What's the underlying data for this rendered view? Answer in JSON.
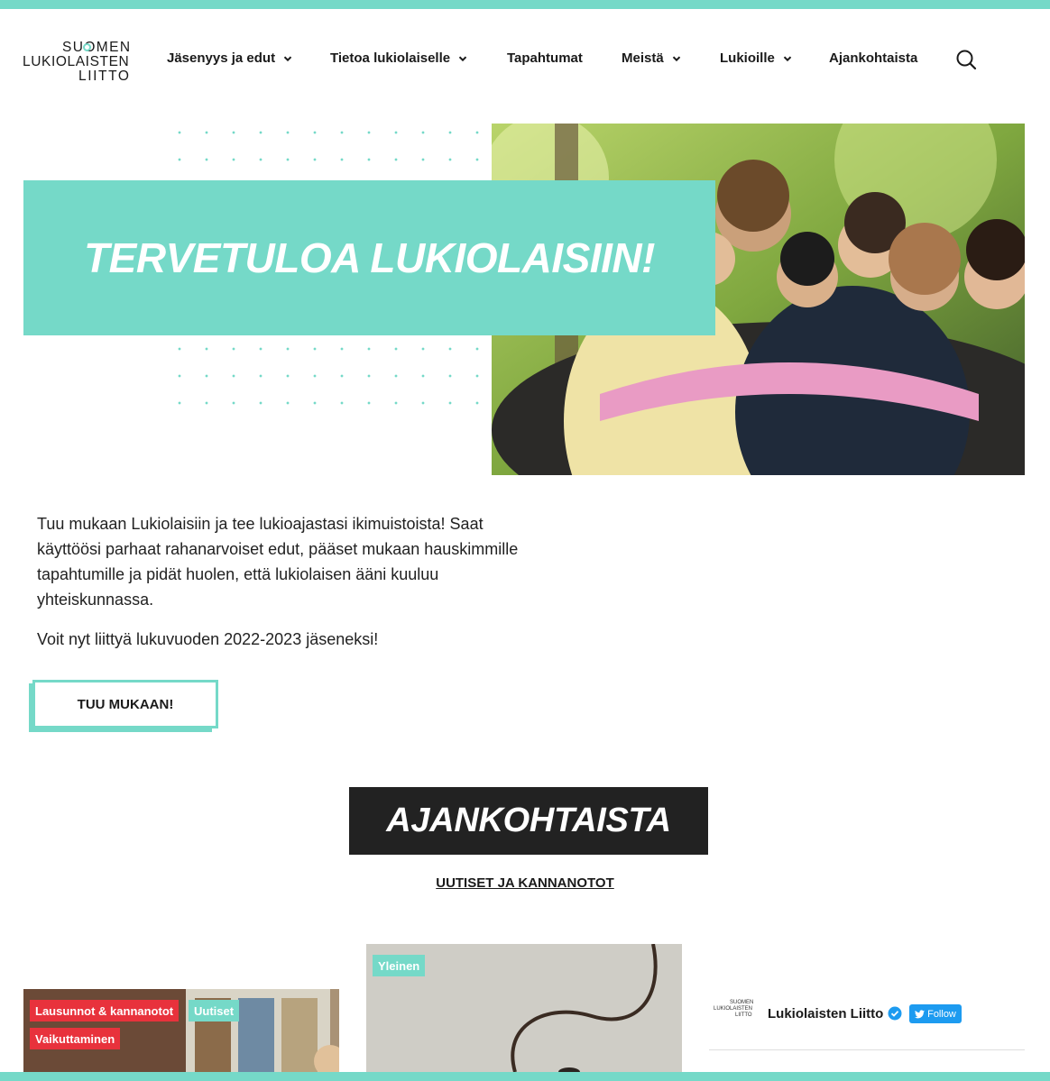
{
  "logo": {
    "line1": "SUOMEN",
    "line2": "LUKIOLAISTEN",
    "line3": "LIITTO"
  },
  "nav": {
    "items": [
      {
        "label": "Jäsenyys ja edut",
        "dropdown": true
      },
      {
        "label": "Tietoa lukiolaiselle",
        "dropdown": true
      },
      {
        "label": "Tapahtumat",
        "dropdown": false
      },
      {
        "label": "Meistä",
        "dropdown": true
      },
      {
        "label": "Lukioille",
        "dropdown": true
      },
      {
        "label": "Ajankohtaista",
        "dropdown": false
      }
    ],
    "search_icon": "search-icon"
  },
  "hero": {
    "title": "TERVETULOA LUKIOLAISIIN!",
    "paragraph1": "Tuu mukaan Lukiolaisiin ja tee lukioajastasi ikimuistoista! Saat käyttöösi parhaat rahanarvoiset edut, pääset mukaan hauskimmille tapahtumille ja pidät huolen, että lukiolaisen ääni kuuluu yhteiskunnassa.",
    "paragraph2": "Voit nyt liittyä lukuvuoden 2022-2023 jäseneksi!",
    "cta": "TUU MUKAAN!"
  },
  "news": {
    "heading": "AJANKOHTAISTA",
    "link": "UUTISET JA KANNANOTOT",
    "card1_tags": [
      "Lausunnot & kannanotot",
      "Uutiset",
      "Vaikuttaminen"
    ],
    "card2_tags": [
      "Yleinen"
    ]
  },
  "twitter": {
    "name": "Lukiolaisten Liitto",
    "follow": "Follow",
    "logo_line1": "SUOMEN",
    "logo_line2": "LUKIOLAISTEN",
    "logo_line3": "LIITTO"
  },
  "colors": {
    "accent": "#75d9c8",
    "dark": "#222222",
    "red": "#e8323c",
    "twitter": "#1d9bf0"
  }
}
